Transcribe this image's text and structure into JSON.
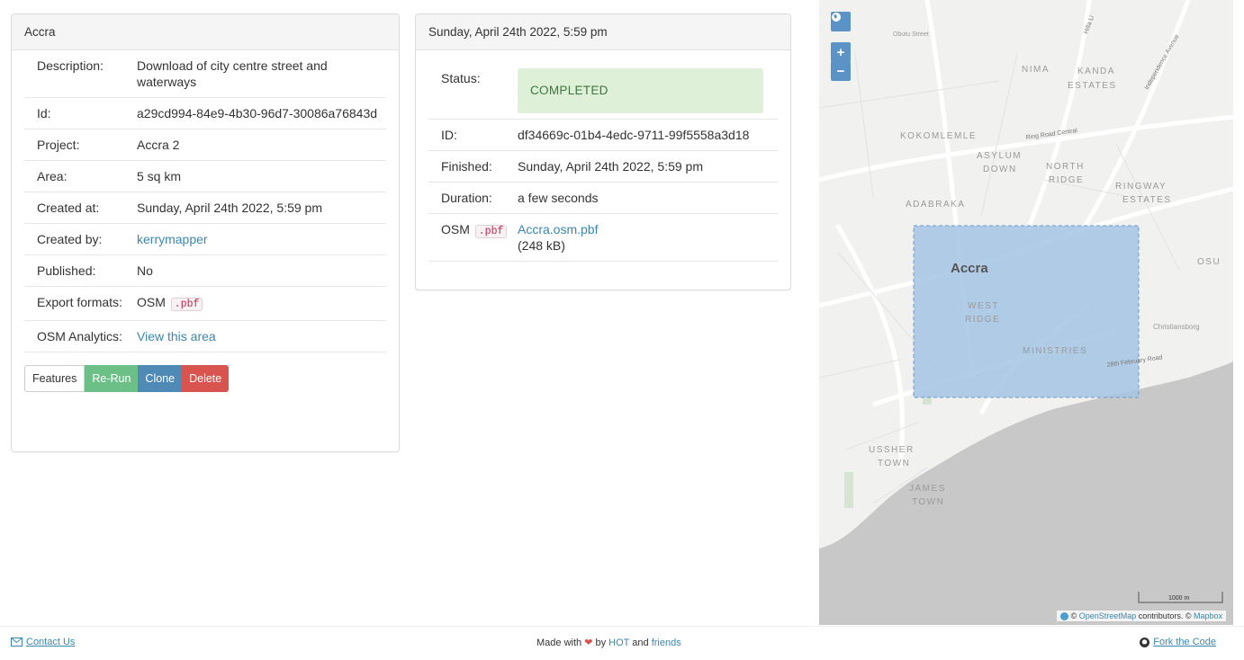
{
  "details": {
    "title": "Accra",
    "rows": [
      {
        "label": "Description:",
        "value": "Download of city centre street and waterways"
      },
      {
        "label": "Id:",
        "value": "a29cd994-84e9-4b30-96d7-30086a76843d"
      },
      {
        "label": "Project:",
        "value": "Accra 2"
      },
      {
        "label": "Area:",
        "value": "5 sq km"
      },
      {
        "label": "Created at:",
        "value": "Sunday, April 24th 2022, 5:59 pm"
      },
      {
        "label": "Created by:",
        "value": "kerrymapper"
      },
      {
        "label": "Published:",
        "value": "No"
      },
      {
        "label": "Export formats:",
        "value": "OSM",
        "code": ".pbf"
      },
      {
        "label": "OSM Analytics:",
        "value": "View this area"
      }
    ],
    "buttons": {
      "features": "Features",
      "rerun": "Re-Run",
      "clone": "Clone",
      "delete": "Delete"
    }
  },
  "run": {
    "title": "Sunday, April 24th 2022, 5:59 pm",
    "status_label": "Status:",
    "status": "COMPLETED",
    "id_label": "ID:",
    "id": "df34669c-01b4-4edc-9711-99f5558a3d18",
    "finished_label": "Finished:",
    "finished": "Sunday, April 24th 2022, 5:59 pm",
    "duration_label": "Duration:",
    "duration": "a few seconds",
    "file_label": "OSM",
    "file_code": ".pbf",
    "file_name": "Accra.osm.pbf",
    "file_size": "(248 kB)"
  },
  "map": {
    "zoom_in": "+",
    "zoom_out": "−",
    "labels": {
      "obuto": "Obutu Street",
      "nima": "NIMA",
      "kanda": "KANDA",
      "estates1": "ESTATES",
      "kokomlemle": "KOKOMLEMLE",
      "ringroad": "Ring Road Central",
      "asylum": "ASYLUM",
      "down": "DOWN",
      "north": "NORTH",
      "ridge1": "RIDGE",
      "ringway": "RINGWAY",
      "estates2": "ESTATES",
      "adabraka": "ADABRAKA",
      "accra": "Accra",
      "osu": "OSU",
      "west": "WEST",
      "ridge2": "RIDGE",
      "christiansborg": "Christiansborg",
      "ministries": "MINISTRIES",
      "feb": "28th February Road",
      "ussher": "USSHER",
      "town1": "TOWN",
      "james": "JAMES",
      "town2": "TOWN",
      "independence": "Independence Avenue",
      "hilla": "Hilla Li",
      "scale": "1000 m"
    },
    "attribution_prefix": "©",
    "attribution_osm": "OpenStreetMap",
    "attribution_mid": "contributors. ©",
    "attribution_mapbox": "Mapbox"
  },
  "footer": {
    "contact": "Contact Us",
    "made_with": "Made with",
    "by": "by",
    "hot": "HOT",
    "and": "and",
    "friends": "friends",
    "fork": "Fork the Code"
  }
}
